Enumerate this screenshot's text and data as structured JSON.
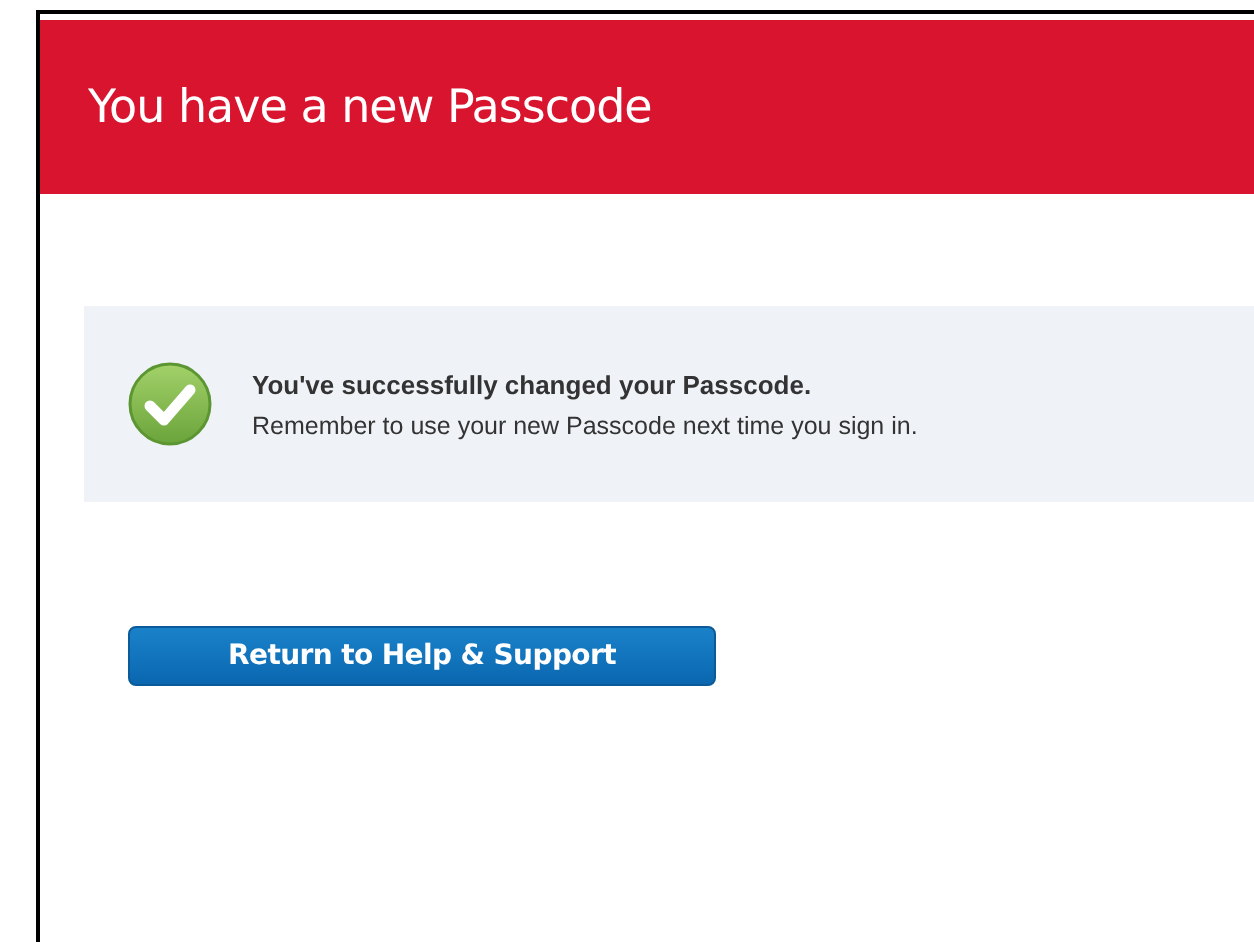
{
  "header": {
    "title": "You have a new Passcode"
  },
  "message": {
    "kind": "success",
    "heading": "You've successfully changed your Passcode.",
    "text": "Remember to use your new Passcode next time you sign in."
  },
  "buttons": [
    "Return to Help & Support"
  ]
}
